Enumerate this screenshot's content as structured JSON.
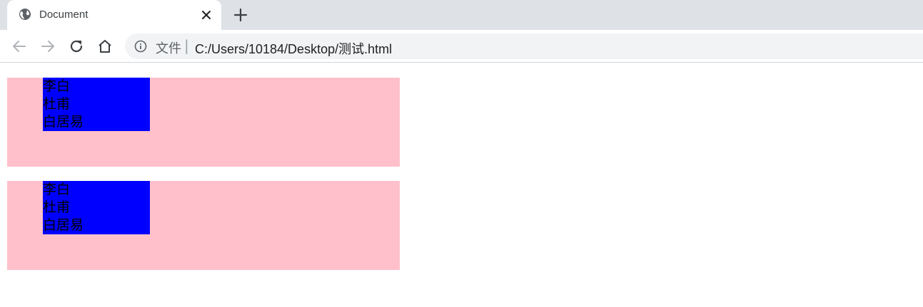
{
  "browser": {
    "tab": {
      "title": "Document",
      "favicon": "globe-icon",
      "close_icon": "close-icon"
    },
    "new_tab_icon": "plus-icon",
    "toolbar": {
      "back_icon": "arrow-left-icon",
      "forward_icon": "arrow-right-icon",
      "reload_icon": "reload-icon",
      "home_icon": "home-icon"
    },
    "omnibox": {
      "info_icon": "info-icon",
      "chip_label": "文件",
      "separator": "|",
      "url": "C:/Users/10184/Desktop/测试.html"
    }
  },
  "page": {
    "boxes": [
      {
        "items": [
          "李白",
          "杜甫",
          "白居易"
        ]
      },
      {
        "items": [
          "李白",
          "杜甫",
          "白居易"
        ]
      }
    ],
    "colors": {
      "box_background": "#ffc0cb",
      "list_background": "#0000ff"
    }
  }
}
